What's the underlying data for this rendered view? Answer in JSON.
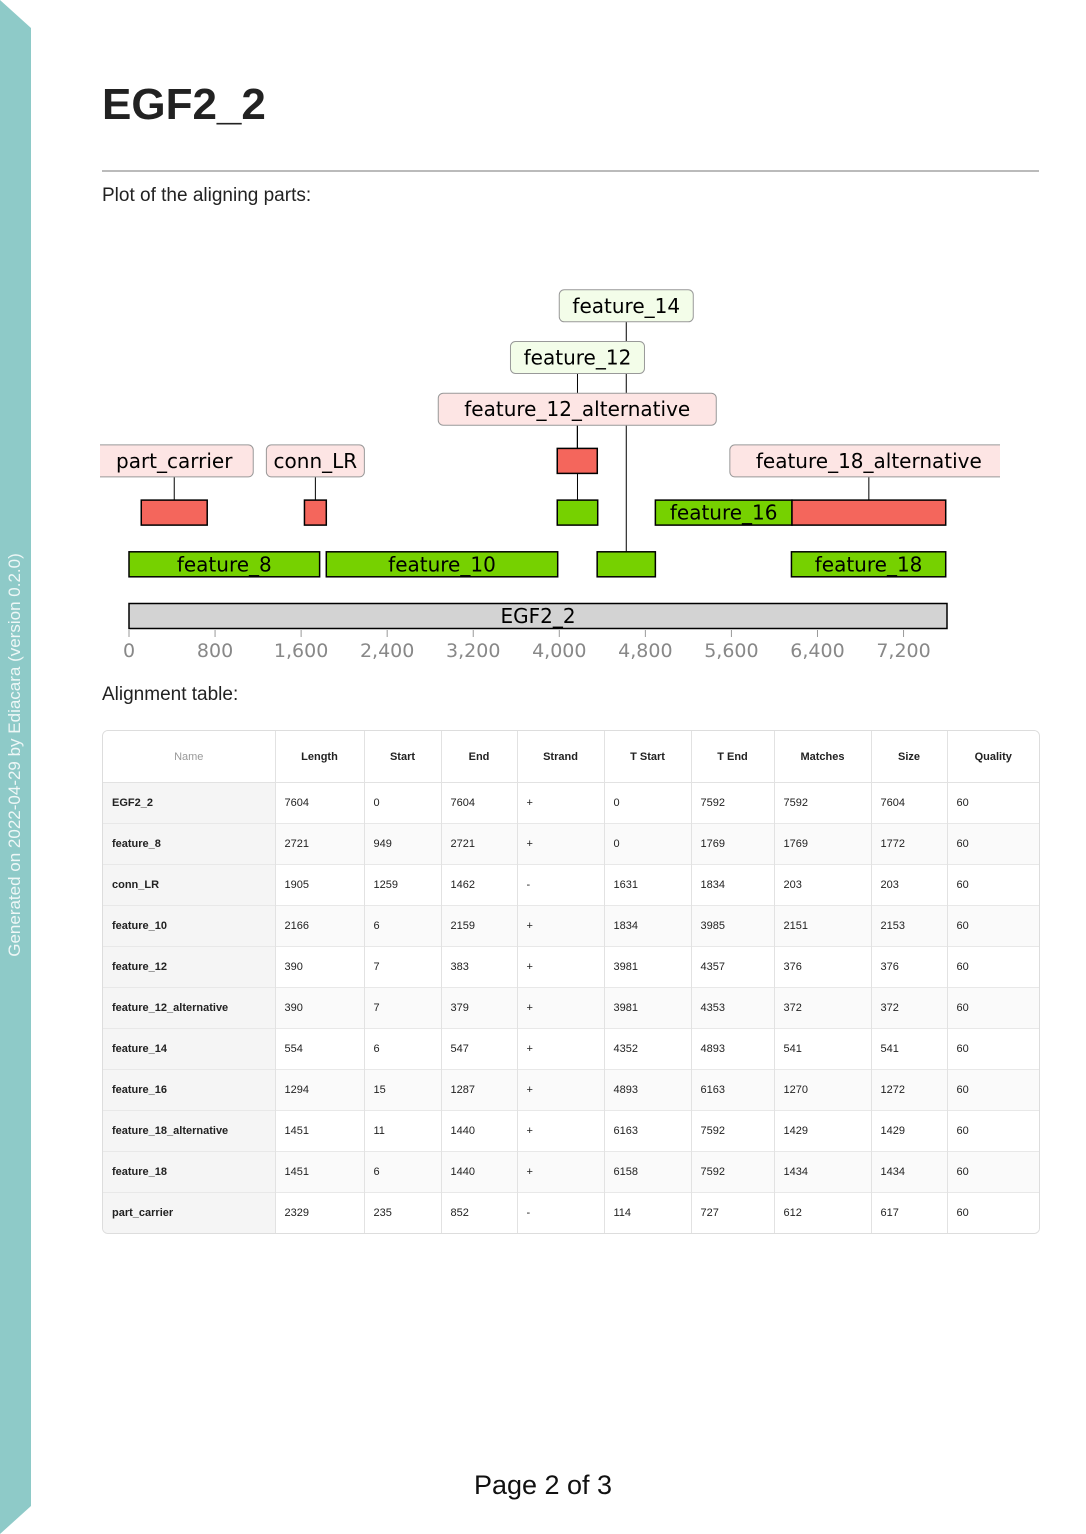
{
  "sidebar": {
    "generated_text": "Generated on 2022-04-29 by Ediacara (version 0.2.0)"
  },
  "header": {
    "title": "EGF2_2"
  },
  "plot_caption": "Plot of the aligning parts:",
  "table_caption": "Alignment table:",
  "colors": {
    "aligned": "#76d100",
    "flagged": "#f4665c",
    "reference": "#d3d3d3",
    "label_green": "#f3fde9",
    "label_red": "#fde5e4",
    "sidebar": "#8ecac8"
  },
  "chart_data": {
    "type": "feature-map",
    "x_range": [
      0,
      7604
    ],
    "x_ticks": [
      0,
      800,
      1600,
      2400,
      3200,
      4000,
      4800,
      5600,
      6400,
      7200
    ],
    "x_tick_labels": [
      "0",
      "800",
      "1,600",
      "2,400",
      "3,200",
      "4,000",
      "4,800",
      "5,600",
      "6,400",
      "7,200"
    ],
    "reference": {
      "label": "EGF2_2",
      "start": 0,
      "end": 7604
    },
    "features": [
      {
        "label": "feature_8",
        "start": 0,
        "end": 1772,
        "color": "green",
        "level": 1,
        "label_mode": "inline"
      },
      {
        "label": "feature_10",
        "start": 1834,
        "end": 3985,
        "color": "green",
        "level": 1,
        "label_mode": "inline"
      },
      {
        "label": "feature_14",
        "start": 4352,
        "end": 4893,
        "color": "green",
        "level": 1,
        "label_mode": "box",
        "label_level": 6
      },
      {
        "label": "feature_18",
        "start": 6158,
        "end": 7592,
        "color": "green",
        "level": 1,
        "label_mode": "inline"
      },
      {
        "label": "part_carrier",
        "start": 114,
        "end": 727,
        "color": "red",
        "level": 2,
        "label_mode": "box",
        "label_level": 3
      },
      {
        "label": "conn_LR",
        "start": 1631,
        "end": 1834,
        "color": "red",
        "level": 2,
        "label_mode": "box",
        "label_level": 3
      },
      {
        "label": "feature_12",
        "start": 3981,
        "end": 4357,
        "color": "green",
        "level": 2,
        "label_mode": "box",
        "label_level": 5
      },
      {
        "label": "feature_16",
        "start": 4893,
        "end": 6163,
        "color": "green",
        "level": 2,
        "label_mode": "inline"
      },
      {
        "label": "feature_18_alternative",
        "start": 6163,
        "end": 7592,
        "color": "red",
        "level": 2,
        "label_mode": "box",
        "label_level": 3
      },
      {
        "label": "feature_12_alternative",
        "start": 3981,
        "end": 4353,
        "color": "red",
        "level": 3,
        "label_mode": "box",
        "label_level": 4
      }
    ]
  },
  "table": {
    "columns": [
      "Name",
      "Length",
      "Start",
      "End",
      "Strand",
      "T Start",
      "T End",
      "Matches",
      "Size",
      "Quality"
    ],
    "rows": [
      [
        "EGF2_2",
        "7604",
        "0",
        "7604",
        "+",
        "0",
        "7592",
        "7592",
        "7604",
        "60"
      ],
      [
        "feature_8",
        "2721",
        "949",
        "2721",
        "+",
        "0",
        "1769",
        "1769",
        "1772",
        "60"
      ],
      [
        "conn_LR",
        "1905",
        "1259",
        "1462",
        "-",
        "1631",
        "1834",
        "203",
        "203",
        "60"
      ],
      [
        "feature_10",
        "2166",
        "6",
        "2159",
        "+",
        "1834",
        "3985",
        "2151",
        "2153",
        "60"
      ],
      [
        "feature_12",
        "390",
        "7",
        "383",
        "+",
        "3981",
        "4357",
        "376",
        "376",
        "60"
      ],
      [
        "feature_12_alternative",
        "390",
        "7",
        "379",
        "+",
        "3981",
        "4353",
        "372",
        "372",
        "60"
      ],
      [
        "feature_14",
        "554",
        "6",
        "547",
        "+",
        "4352",
        "4893",
        "541",
        "541",
        "60"
      ],
      [
        "feature_16",
        "1294",
        "15",
        "1287",
        "+",
        "4893",
        "6163",
        "1270",
        "1272",
        "60"
      ],
      [
        "feature_18_alternative",
        "1451",
        "11",
        "1440",
        "+",
        "6163",
        "7592",
        "1429",
        "1429",
        "60"
      ],
      [
        "feature_18",
        "1451",
        "6",
        "1440",
        "+",
        "6158",
        "7592",
        "1434",
        "1434",
        "60"
      ],
      [
        "part_carrier",
        "2329",
        "235",
        "852",
        "-",
        "114",
        "727",
        "612",
        "617",
        "60"
      ]
    ]
  },
  "footer": {
    "page_label": "Page 2 of 3"
  }
}
